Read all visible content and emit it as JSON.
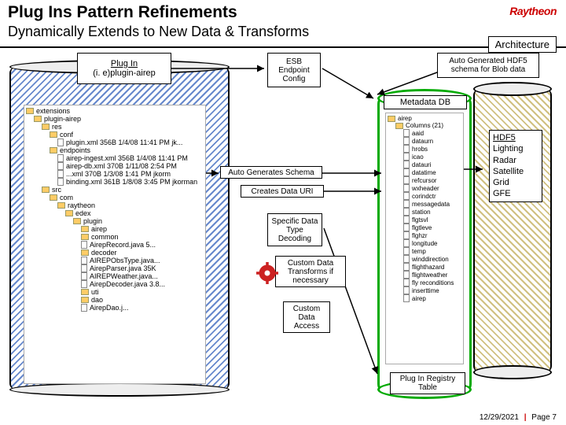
{
  "header": {
    "title": "Plug Ins Pattern Refinements",
    "subtitle": "Dynamically Extends to New Data & Transforms",
    "logo": "Raytheon",
    "arch": "Architecture"
  },
  "boxes": {
    "plugin_title": "Plug In",
    "plugin_sub": "(i. e)plugin-airep",
    "esb": "ESB Endpoint Config",
    "auto_hdf5": "Auto Generated HDF5 schema for Blob data",
    "meta": "Metadata DB",
    "registry": "Plug In Registry Table",
    "agen": "Auto Generates Schema",
    "uri": "Creates Data URI",
    "spec": "Specific Data Type Decoding",
    "cust1": "Custom Data Transforms if necessary",
    "cust2": "Custom Data Access"
  },
  "hdf5": {
    "title": "HDF5",
    "items": [
      "Lighting",
      "Radar",
      "Satellite",
      "Grid",
      "GFE"
    ]
  },
  "left_tree": [
    {
      "lvl": 0,
      "type": "folder",
      "label": "extensions"
    },
    {
      "lvl": 1,
      "type": "folder",
      "label": "plugin-airep"
    },
    {
      "lvl": 2,
      "type": "folder",
      "label": "res"
    },
    {
      "lvl": 3,
      "type": "folder",
      "label": "conf"
    },
    {
      "lvl": 4,
      "type": "file",
      "label": "plugin.xml 356B  1/4/08 11:41 PM  jk..."
    },
    {
      "lvl": 3,
      "type": "folder",
      "label": "endpoints"
    },
    {
      "lvl": 4,
      "type": "file",
      "label": "airep-ingest.xml 356B  1/4/08 11:41 PM"
    },
    {
      "lvl": 4,
      "type": "file",
      "label": "airep-db.xml 370B  1/11/08 2:54 PM"
    },
    {
      "lvl": 4,
      "type": "file",
      "label": "...xml 370B  1/3/08 1:41 PM  jkorm"
    },
    {
      "lvl": 4,
      "type": "file",
      "label": "binding.xml 361B  1/8/08 3:45 PM  jkorman"
    },
    {
      "lvl": 2,
      "type": "folder",
      "label": "src"
    },
    {
      "lvl": 3,
      "type": "folder",
      "label": "com"
    },
    {
      "lvl": 4,
      "type": "folder",
      "label": "raytheon"
    },
    {
      "lvl": 5,
      "type": "folder",
      "label": "edex"
    },
    {
      "lvl": 6,
      "type": "folder",
      "label": "plugin"
    },
    {
      "lvl": 7,
      "type": "folder",
      "label": "airep"
    },
    {
      "lvl": 7,
      "type": "folder",
      "label": "common"
    },
    {
      "lvl": 7,
      "type": "file",
      "label": "AirepRecord.java 5..."
    },
    {
      "lvl": 7,
      "type": "folder",
      "label": "decoder"
    },
    {
      "lvl": 7,
      "type": "file",
      "label": "AIREPObsType.java..."
    },
    {
      "lvl": 7,
      "type": "file",
      "label": "AirepParser.java 35K"
    },
    {
      "lvl": 7,
      "type": "file",
      "label": "AIREPWeather.java..."
    },
    {
      "lvl": 7,
      "type": "file",
      "label": "AirepDecoder.java 3.8..."
    },
    {
      "lvl": 7,
      "type": "folder",
      "label": "uti"
    },
    {
      "lvl": 7,
      "type": "folder",
      "label": "dao"
    },
    {
      "lvl": 7,
      "type": "file",
      "label": "AirepDao.j..."
    }
  ],
  "right_tree": {
    "header": "airep",
    "sub": "Columns (21)",
    "cols": [
      "aaid",
      "dataurn",
      "hrobs",
      "icao",
      "datauri",
      "datatime",
      "refcursor",
      "wxheader",
      "corindctr",
      "messagedata",
      "station",
      "flgtsvl",
      "flgtleve",
      "flghzr",
      "longitude",
      "temp",
      "winddirection",
      "flighthazard",
      "flightweather",
      "fly reconditions",
      "inserttime",
      "airep"
    ]
  },
  "footer": {
    "date": "12/29/2021",
    "page": "Page 7"
  }
}
